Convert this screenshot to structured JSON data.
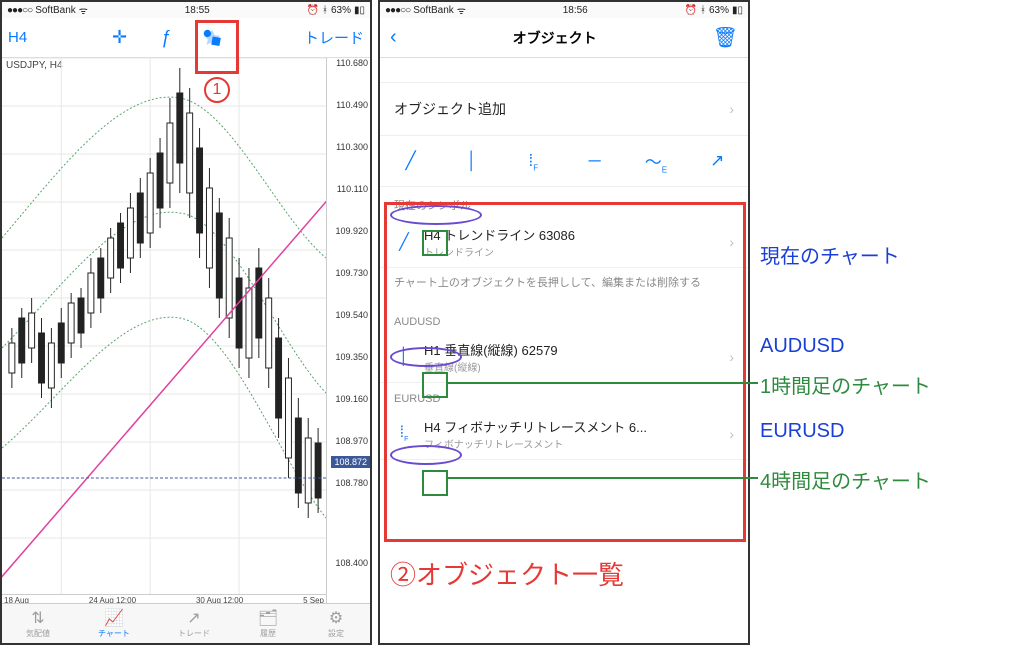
{
  "status_left": {
    "carrier": "SoftBank",
    "wifi": "📶"
  },
  "status_time_left": "18:55",
  "status_time_right": "18:56",
  "status_right": {
    "bt": "⌁",
    "battery": "63%"
  },
  "left": {
    "tf_label": "H4",
    "trade_label": "トレード",
    "symbol": "USDJPY, H4",
    "price_ticks": [
      "110.680",
      "110.490",
      "110.300",
      "110.110",
      "109.920",
      "109.730",
      "109.540",
      "109.350",
      "109.160",
      "108.970",
      "108.780",
      "108.400"
    ],
    "price_current": "108.872",
    "time_ticks": [
      "18 Aug",
      "24 Aug 12:00",
      "30 Aug 12:00",
      "5 Sep"
    ]
  },
  "tabs": [
    {
      "label": "気配値"
    },
    {
      "label": "チャート"
    },
    {
      "label": "トレード"
    },
    {
      "label": "履歴"
    },
    {
      "label": "設定"
    }
  ],
  "right": {
    "title": "オブジェクト",
    "add_label": "オブジェクト追加",
    "groups": {
      "current": {
        "label": "現在のシンボル",
        "item_title": "H4 トレンドライン 63086",
        "item_sub": "トレンドライン"
      },
      "hint": "チャート上のオブジェクトを長押しして、編集または削除する",
      "audusd": {
        "label": "AUDUSD",
        "item_title": "H1 垂直線(縦線) 62579",
        "item_sub": "垂直線(縦線)"
      },
      "eurusd": {
        "label": "EURUSD",
        "item_title": "H4 フィボナッチリトレースメント 6...",
        "item_sub": "フィボナッチリトレースメント"
      }
    }
  },
  "annot": {
    "side1": "現在のチャート",
    "side2": "AUDUSD",
    "side3": "1時間足のチャート",
    "side4": "EURUSD",
    "side5": "4時間足のチャート",
    "bottom": "②オブジェクト一覧",
    "num1": "1"
  },
  "chart_data": {
    "type": "candlestick",
    "symbol": "USDJPY",
    "timeframe": "H4",
    "y_range": [
      108.4,
      110.68
    ],
    "overlays": [
      "bollinger-bands",
      "trendline-magenta"
    ],
    "x_labels": [
      "18 Aug",
      "24 Aug 12:00",
      "30 Aug 12:00",
      "5 Sep"
    ],
    "last_price": 108.872
  }
}
